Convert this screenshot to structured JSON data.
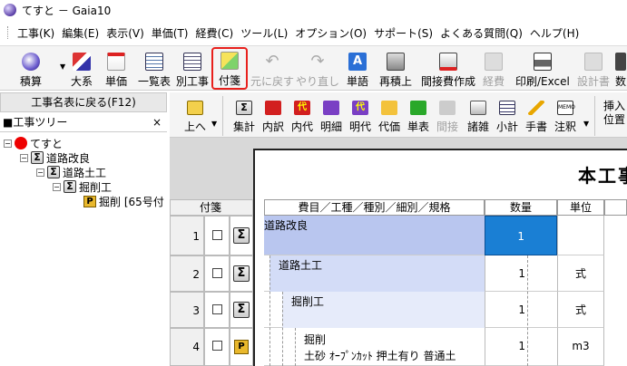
{
  "window": {
    "title": "てすと － Gaia10"
  },
  "menu": [
    "工事(K)",
    "編集(E)",
    "表示(V)",
    "単価(T)",
    "経費(C)",
    "ツール(L)",
    "オプション(O)",
    "サポート(S)",
    "よくある質問(Q)",
    "ヘルプ(H)"
  ],
  "toolbar": {
    "sekisan": "積算",
    "taikei": "大系",
    "tanka": "単価",
    "ichiranhyo": "一覧表",
    "betsukouji": "別工事",
    "fusen": "付箋",
    "moto": "元に戻す",
    "yarinaoshi": "やり直し",
    "tango": "単語",
    "saisekijo": "再積上",
    "kansetsuhi": "間接費作成",
    "keihi": "経費",
    "insatsu": "印刷/Excel",
    "sekkeisho": "設計書",
    "su": "数"
  },
  "left": {
    "back_button": "工事名表に戻る(F12)",
    "tree_title": "■工事ツリー",
    "close": "×",
    "tree": {
      "root": "てすと",
      "n1": "道路改良",
      "n2": "道路土工",
      "n3": "掘削工",
      "n4": "掘削 [65号付"
    }
  },
  "toolbar2": {
    "ue": "上へ",
    "shukei": "集計",
    "uchiwake": "内訳",
    "uchidai": "内代",
    "meisai": "明細",
    "meidai": "明代",
    "daika": "代価",
    "tanpyo": "単表",
    "kankai": "間接",
    "shozatsu": "諸雑",
    "shokei": "小計",
    "tegaki": "手書",
    "chuki": "注釈",
    "sounyu": "挿入",
    "ichi": "位置"
  },
  "sheet": {
    "title": "本工事",
    "tag_header": "付箋",
    "headers": {
      "name": "費目／工種／種別／細別／規格",
      "qty": "数量",
      "unit": "単位"
    },
    "rows": [
      {
        "num": "1",
        "name": "道路改良",
        "qty": "1",
        "unit": ""
      },
      {
        "num": "2",
        "name": "道路土工",
        "qty": "1",
        "unit": "式"
      },
      {
        "num": "3",
        "name": "掘削工",
        "qty": "1",
        "unit": "式"
      },
      {
        "num": "4",
        "name": "掘削",
        "name2": "土砂 ｵｰﾌﾟﾝｶｯﾄ 押土有り 普通土",
        "qty": "1",
        "unit": "m3"
      }
    ]
  },
  "colors": {
    "selected_cell": "#1a7fd4",
    "highlight_border": "#e8201c",
    "row_highlight": "#b9c6ef"
  }
}
